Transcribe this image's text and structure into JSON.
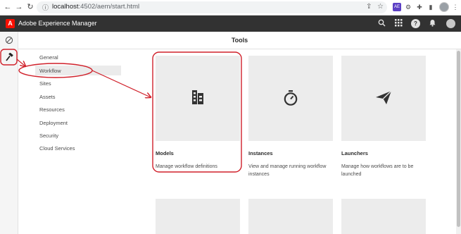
{
  "browser": {
    "url_host": "localhost",
    "url_rest": ":4502/aem/start.html",
    "icons": [
      "back-icon",
      "forward-icon",
      "reload-icon",
      "share-icon",
      "star-icon",
      "extension-icon",
      "puzzle-icon",
      "sidebar-icon",
      "profile-icon",
      "menu-icon"
    ]
  },
  "header": {
    "logo_letter": "A",
    "title": "Adobe Experience Manager",
    "accent_color": "#fa0f00"
  },
  "page": {
    "title": "Tools"
  },
  "tools_nav": {
    "items": [
      {
        "label": "General"
      },
      {
        "label": "Workflow"
      },
      {
        "label": "Sites"
      },
      {
        "label": "Assets"
      },
      {
        "label": "Resources"
      },
      {
        "label": "Deployment"
      },
      {
        "label": "Security"
      },
      {
        "label": "Cloud Services"
      }
    ],
    "selected": "Workflow"
  },
  "cards": [
    {
      "title": "Models",
      "description": "Manage workflow definitions",
      "icon": "workflow-model-icon"
    },
    {
      "title": "Instances",
      "description": "View and manage running workflow instances",
      "icon": "stopwatch-icon"
    },
    {
      "title": "Launchers",
      "description": "Manage how workflows are to be launched",
      "icon": "paper-plane-icon"
    }
  ],
  "annotation_color": "#d0202a"
}
